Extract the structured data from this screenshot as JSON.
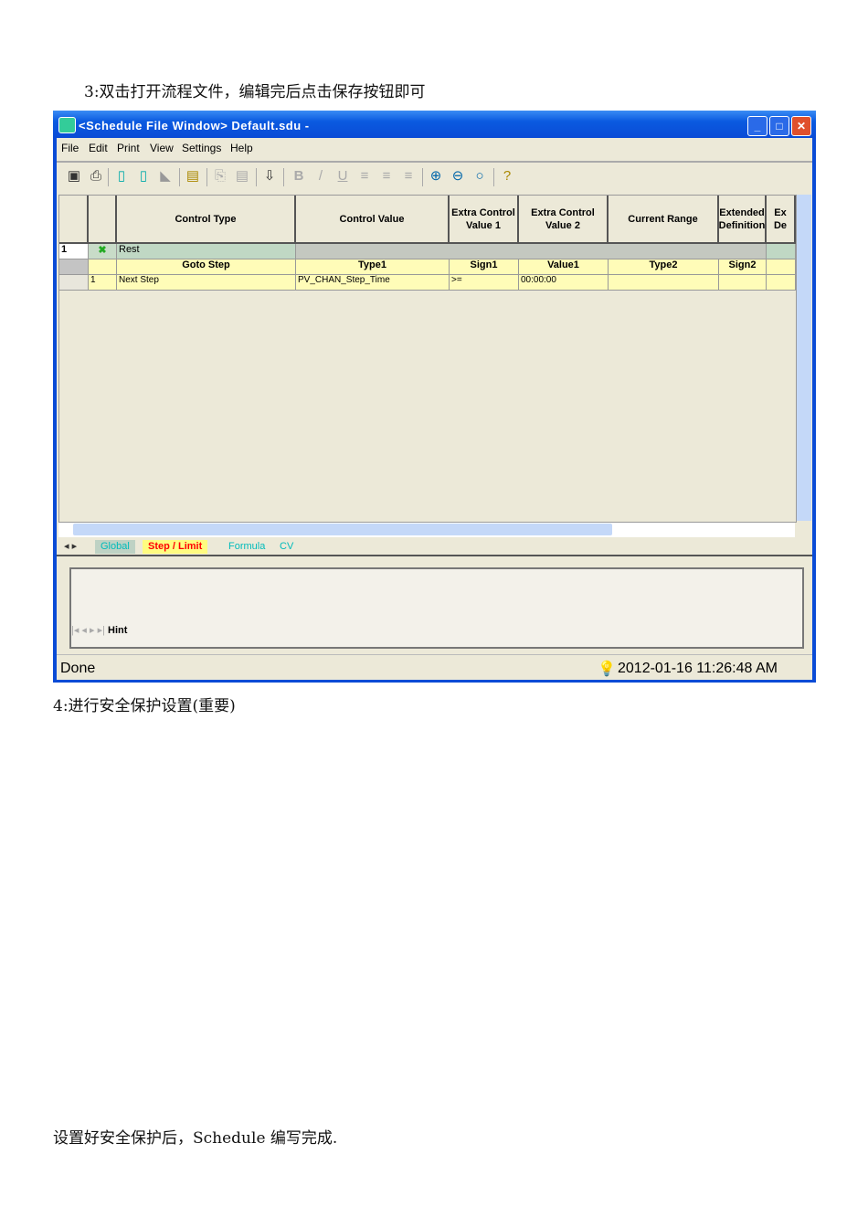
{
  "doc": {
    "step3": "3:双击打开流程文件，编辑完后点击保存按钮即可",
    "step4": "4:进行安全保护设置(重要)",
    "footer": "设置好安全保护后，Schedule 编写完成."
  },
  "window": {
    "title": "<Schedule File Window>  Default.sdu -",
    "menu": [
      "File",
      "Edit",
      "Print",
      "View",
      "Settings",
      "Help"
    ],
    "headers": [
      "Control Type",
      "Control Value",
      "Extra Control Value 1",
      "Extra Control Value 2",
      "Current Range",
      "Extended Definition",
      "Ex De"
    ],
    "row1": {
      "num": "1",
      "control_type": "Rest"
    },
    "sub_headers": [
      "Goto Step",
      "Type1",
      "Sign1",
      "Value1",
      "Type2",
      "Sign2"
    ],
    "row3": {
      "num": "1",
      "goto": "Next Step",
      "type1": "PV_CHAN_Step_Time",
      "sign1": ">=",
      "value1": "00:00:00"
    },
    "tabs": [
      "Global",
      "Step / Limit",
      "Formula",
      "CV"
    ],
    "hint_tab": "Hint",
    "status": "Done",
    "datetime": "2012-01-16 11:26:48 AM"
  }
}
